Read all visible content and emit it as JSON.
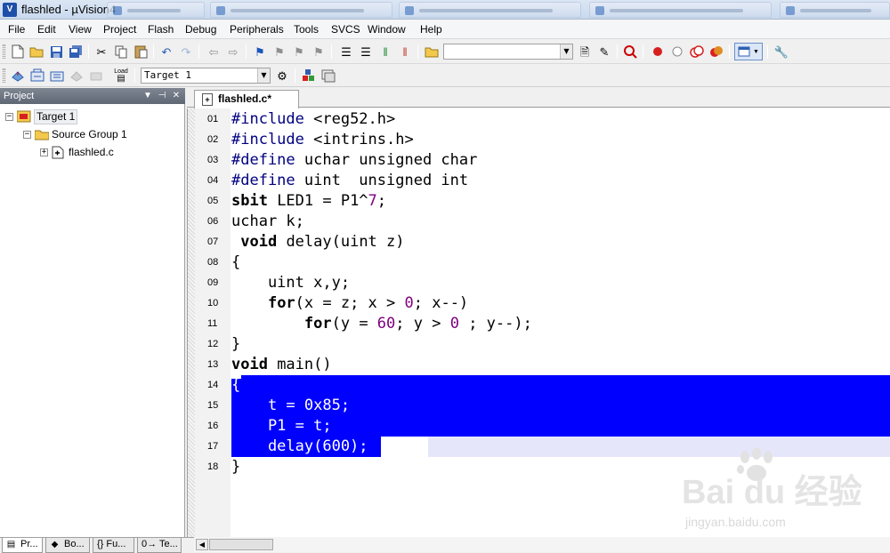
{
  "window": {
    "title": "flashled - µVision4",
    "app_icon_text": "V"
  },
  "menu": [
    "File",
    "Edit",
    "View",
    "Project",
    "Flash",
    "Debug",
    "Peripherals",
    "Tools",
    "SVCS",
    "Window",
    "Help"
  ],
  "toolbar": {
    "find_combo_value": "",
    "target_combo_value": "Target 1",
    "load_label": "Load"
  },
  "project_panel": {
    "title": "Project",
    "tree": [
      {
        "label": "Target 1",
        "level": 0
      },
      {
        "label": "Source Group 1",
        "level": 1
      },
      {
        "label": "flashled.c",
        "level": 2
      }
    ]
  },
  "bottom_tabs": [
    {
      "label": "Pr...",
      "icon": "project-icon"
    },
    {
      "label": "Bo...",
      "icon": "books-icon"
    },
    {
      "label": "{} Fu...",
      "icon": "functions-icon"
    },
    {
      "label": "0→ Te...",
      "icon": "templates-icon"
    }
  ],
  "editor": {
    "active_tab": "flashled.c*",
    "selection_color": "#0000ff",
    "lines": [
      {
        "n": "01",
        "text": "#include <reg52.h>"
      },
      {
        "n": "02",
        "text": "#include <intrins.h>"
      },
      {
        "n": "03",
        "text": "#define uchar unsigned char"
      },
      {
        "n": "04",
        "text": "#define uint  unsigned int"
      },
      {
        "n": "05",
        "text": "sbit LED1 = P1^7;"
      },
      {
        "n": "06",
        "text": "uchar k;"
      },
      {
        "n": "07",
        "text": " void delay(uint z)"
      },
      {
        "n": "08",
        "text": "{"
      },
      {
        "n": "09",
        "text": "    uint x,y;"
      },
      {
        "n": "10",
        "text": "    for(x = z; x > 0; x--)"
      },
      {
        "n": "11",
        "text": "        for(y = 60; y > 0 ; y--);"
      },
      {
        "n": "12",
        "text": "}"
      },
      {
        "n": "13",
        "text": "void main()"
      },
      {
        "n": "14",
        "text": "{"
      },
      {
        "n": "15",
        "text": "    t = 0x85;"
      },
      {
        "n": "16",
        "text": "    P1 = t;"
      },
      {
        "n": "17",
        "text": "    delay(600);"
      },
      {
        "n": "18",
        "text": "}"
      }
    ]
  },
  "watermark": {
    "brand": "Bai du 经验",
    "url": "jingyan.baidu.com"
  }
}
